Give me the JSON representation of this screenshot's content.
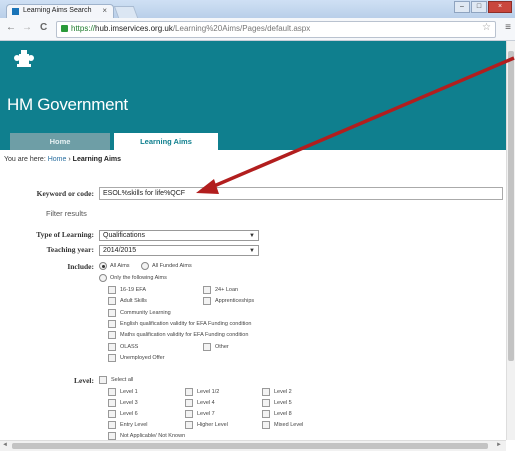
{
  "browser": {
    "tab_title": "Learning Aims Search",
    "tab_close": "×",
    "win_min": "–",
    "win_max": "□",
    "win_close": "×",
    "nav_back": "←",
    "nav_forward": "→",
    "nav_reload": "C",
    "url_scheme": "https://",
    "url_host": "hub.imservices.org.uk",
    "url_path": "/Learning%20Aims/Pages/default.aspx",
    "star": "☆",
    "menu": "≡"
  },
  "header": {
    "brand": "HM Government"
  },
  "nav_tabs": [
    "Home",
    "Learning Aims"
  ],
  "breadcrumb": {
    "prefix": "You are here:",
    "home": "Home",
    "separator": "›",
    "current": "Learning Aims"
  },
  "search": {
    "keyword_label": "Keyword or code:",
    "keyword_value": "ESOL%skills for life%QCF",
    "filter_heading": "Filter results",
    "type_label": "Type of Learning:",
    "type_value": "Qualifications",
    "year_label": "Teaching year:",
    "year_value": "2014/2015",
    "include_label": "Include:",
    "include_options": [
      "All Aims",
      "All Funded Aims",
      "Only the following Aims"
    ],
    "aims": [
      "16-19 EFA",
      "24+ Loan",
      "Adult Skills",
      "Apprenticeships",
      "Community Learning",
      "English qualification validity for EFA Funding condition",
      "Maths qualification validity for EFA Funding condition",
      "OLASS",
      "Other",
      "Unemployed Offer"
    ],
    "level_label": "Level:",
    "level_select_all": "Select all",
    "levels": [
      "Level 1",
      "Level 1/2",
      "Level 2",
      "Level 3",
      "Level 4",
      "Level 5",
      "Level 6",
      "Level 7",
      "Level 8",
      "Entry Level",
      "Higher Level",
      "Mixed Level",
      "Not Applicable/ Not Known"
    ]
  },
  "colors": {
    "teal": "#0f7f8e",
    "arrow": "#b21e1e"
  },
  "icons": [
    "favicon-icon",
    "lock-icon",
    "star-icon",
    "menu-icon",
    "crest-icon",
    "dropdown-caret-icon",
    "annotation-arrow"
  ]
}
